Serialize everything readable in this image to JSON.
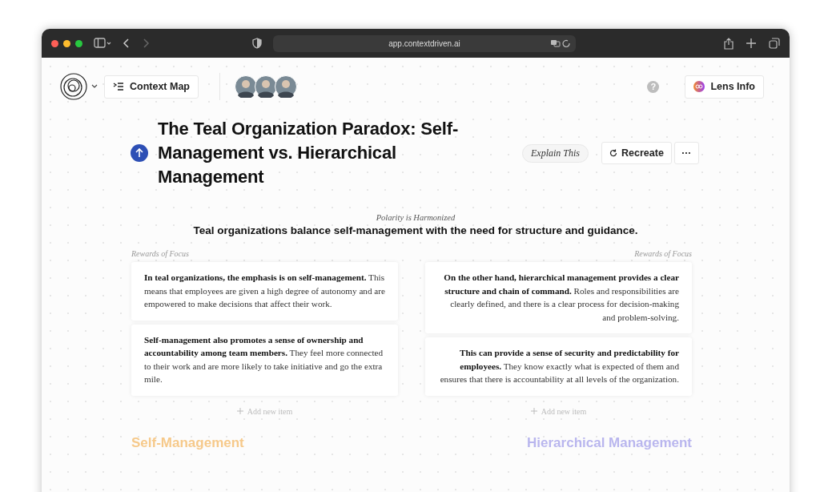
{
  "browser": {
    "url": "app.contextdriven.ai"
  },
  "header": {
    "context_map": "Context Map",
    "avatars": [
      {
        "kind": "avatar"
      },
      {
        "kind": "avatar"
      },
      {
        "kind": "avatar"
      }
    ],
    "help": "?",
    "lens_info": "Lens Info"
  },
  "title": "The Teal Organization Paradox: Self-Management vs. Hierarchical Management",
  "actions": {
    "explain": "Explain This",
    "recreate": "Recreate",
    "more": "···"
  },
  "polarity_status": "Polarity is Harmonized",
  "summary": "Teal organizations balance self-management with the need for structure and guidance.",
  "columns": [
    {
      "kind": "left",
      "heading": "Rewards of Focus",
      "items": [
        "**In teal organizations, the emphasis is on self-management.** This means that employees are given a high degree of autonomy and are empowered to make decisions that affect their work.",
        "**Self-management also promotes a sense of ownership and accountability among team members.** They feel more connected to their work and are more likely to take initiative and go the extra mile."
      ],
      "add": "Add new item",
      "pole": "Self-Management",
      "color": "#f6c98a"
    },
    {
      "kind": "right",
      "heading": "Rewards of Focus",
      "items": [
        "**On the other hand, hierarchical management provides a clear structure and chain of command.** Roles and responsibilities are clearly defined, and there is a clear process for decision-making and problem-solving.",
        "**This can provide a sense of security and predictability for employees.** They know exactly what is expected of them and ensures that there is accountability at all levels of the organization."
      ],
      "add": "Add new item",
      "pole": "Hierarchical Management",
      "color": "#b9b6ee"
    }
  ]
}
